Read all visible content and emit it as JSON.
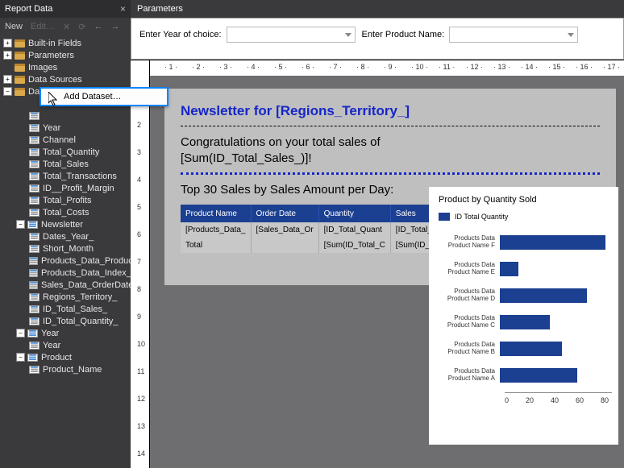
{
  "left_panel": {
    "title": "Report Data",
    "new_btn": "New",
    "edit_btn": "Edit…",
    "nodes": {
      "builtin": "Built-in Fields",
      "parameters": "Parameters",
      "images": "Images",
      "datasources": "Data Sources",
      "datasets": "Datasets",
      "year_f": "Year",
      "channel": "Channel",
      "total_quantity": "Total_Quantity",
      "total_sales": "Total_Sales",
      "total_transactions": "Total_Transactions",
      "id_profit_margin": "ID__Profit_Margin",
      "total_profits": "Total_Profits",
      "total_costs": "Total_Costs",
      "newsletter": "Newsletter",
      "dates_year": "Dates_Year_",
      "short_month": "Short_Month",
      "products_data_product": "Products_Data_Product…",
      "products_data_index": "Products_Data_Index_",
      "sales_data_orderdate": "Sales_Data_OrderDate_…",
      "regions_territory": "Regions_Territory_",
      "id_total_sales": "ID_Total_Sales_",
      "id_total_quantity": "ID_Total_Quantity_",
      "year_ds": "Year",
      "year_field": "Year",
      "product_ds": "Product",
      "product_name": "Product_Name"
    }
  },
  "context_menu": {
    "add_dataset": "Add Dataset…"
  },
  "parameters": {
    "title": "Parameters",
    "year_label": "Enter Year of choice:",
    "product_label": "Enter Product Name:"
  },
  "report": {
    "newsletter_title": "Newsletter for [Regions_Territory_]",
    "congrats_l1": "Congratulations on your total sales of",
    "congrats_l2": "[Sum(ID_Total_Sales_)]!",
    "subhead": "Top 30 Sales by Sales Amount per Day:",
    "table": {
      "h1": "Product Name",
      "h2": "Order Date",
      "h3": "Quantity",
      "h4": "Sales",
      "r1c1": "[Products_Data_",
      "r1c2": "[Sales_Data_Or",
      "r1c3": "[ID_Total_Quant",
      "r1c4": "[ID_Total_Sales",
      "r2c1": "Total",
      "r2c2": "",
      "r2c3": "[Sum(ID_Total_C",
      "r2c4": "[Sum(ID_Total_"
    }
  },
  "chart_data": {
    "type": "bar",
    "title": "Product by Quantity Sold",
    "legend": "ID Total Quantity",
    "categories": [
      "Products Data Product Name  F",
      "Products Data Product Name  E",
      "Products Data Product Name  D",
      "Products Data Product Name  C",
      "Products Data Product Name  B",
      "Products Data Product Name  A"
    ],
    "values": [
      85,
      15,
      70,
      40,
      50,
      62
    ],
    "xlabel": "",
    "ylabel": "",
    "xlim": [
      0,
      90
    ],
    "xticks": [
      "0",
      "20",
      "40",
      "60",
      "80"
    ]
  },
  "ruler_h": [
    "1",
    "2",
    "3",
    "4",
    "5",
    "6",
    "7",
    "8",
    "9",
    "10",
    "11",
    "12",
    "13",
    "14",
    "15",
    "16",
    "17"
  ],
  "ruler_v": [
    "1",
    "2",
    "3",
    "4",
    "5",
    "6",
    "7",
    "8",
    "9",
    "10",
    "11",
    "12",
    "13",
    "14"
  ]
}
